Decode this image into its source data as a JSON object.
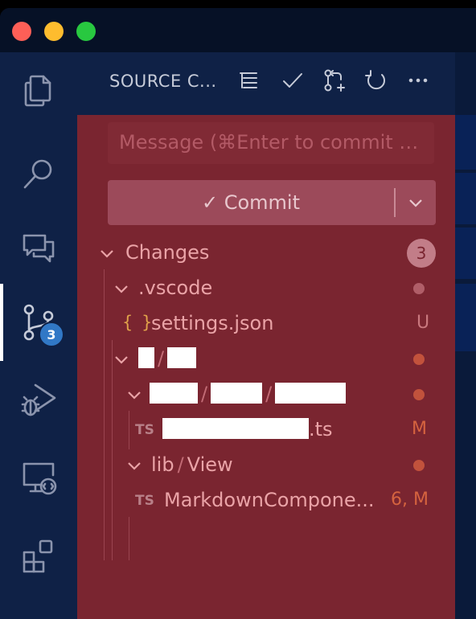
{
  "window": {
    "traffic_lights": [
      "close",
      "minimize",
      "zoom"
    ]
  },
  "activity_bar": {
    "items": [
      {
        "name": "explorer-icon"
      },
      {
        "name": "search-icon"
      },
      {
        "name": "chat-icon"
      },
      {
        "name": "source-control-icon",
        "active": true,
        "badge": "3"
      },
      {
        "name": "run-debug-icon"
      },
      {
        "name": "remote-explorer-icon"
      },
      {
        "name": "extensions-icon"
      }
    ]
  },
  "header": {
    "title": "SOURCE C...",
    "actions": [
      "view-as-tree-icon",
      "commit-check-icon",
      "create-pr-icon",
      "refresh-icon",
      "more-actions-icon"
    ]
  },
  "scm": {
    "message_placeholder": "Message (⌘Enter to commit …",
    "commit_label": "✓ Commit",
    "changes": {
      "label": "Changes",
      "count": "3"
    },
    "tree": {
      "vscode_folder": ".vscode",
      "settings_icon": "{ }",
      "settings_file": "settings.json",
      "settings_status": "U",
      "ts_file_suffix": ".ts",
      "ts_icon": "TS",
      "ts_file_status": "M",
      "lib_folder": "lib",
      "view_folder": "View",
      "markdown_file": "MarkdownCompone...",
      "markdown_status": "6, M"
    }
  },
  "colors": {
    "panel_bg": "#7a2530",
    "activity_bg": "#0f2146",
    "titlebar_bg": "#061126",
    "badge_bg": "#3178c6",
    "accent_text": "#eaa3a7",
    "modified": "#d5633f"
  }
}
